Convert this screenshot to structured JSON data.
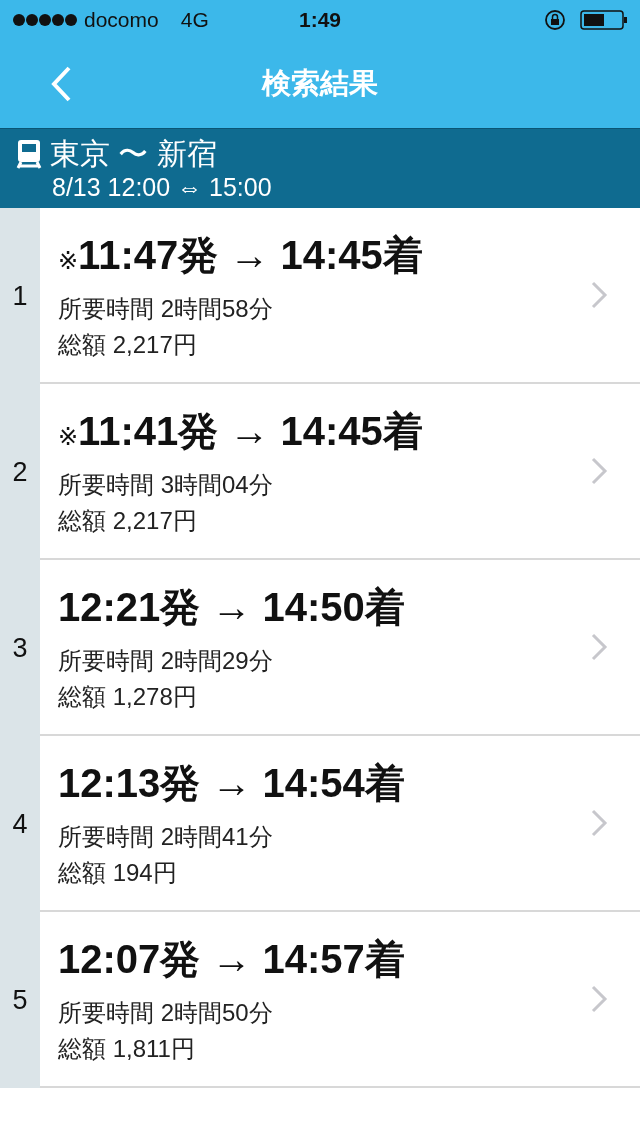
{
  "status_bar": {
    "carrier": "docomo",
    "network": "4G",
    "time": "1:49"
  },
  "nav": {
    "title": "検索結果"
  },
  "route": {
    "stations": "東京 〜 新宿",
    "when": "8/13 12:00 ⇔ 15:00"
  },
  "results": [
    {
      "index": "1",
      "mark": "※",
      "title": "11:47発 → 14:45着",
      "duration": "所要時間 2時間58分",
      "fare": "総額 2,217円"
    },
    {
      "index": "2",
      "mark": "※",
      "title": "11:41発 → 14:45着",
      "duration": "所要時間 3時間04分",
      "fare": "総額 2,217円"
    },
    {
      "index": "3",
      "title": "12:21発 → 14:50着",
      "duration": "所要時間 2時間29分",
      "fare": "総額 1,278円"
    },
    {
      "index": "4",
      "title": "12:13発 → 14:54着",
      "duration": "所要時間 2時間41分",
      "fare": "総額 194円"
    },
    {
      "index": "5",
      "title": "12:07発 → 14:57着",
      "duration": "所要時間 2時間50分",
      "fare": "総額 1,811円"
    }
  ]
}
